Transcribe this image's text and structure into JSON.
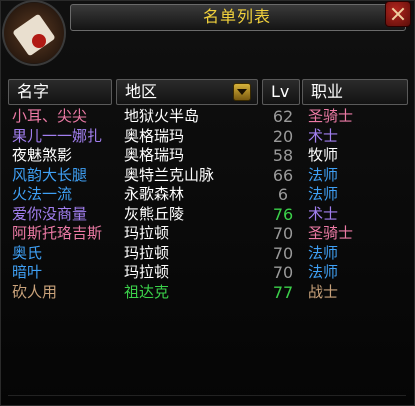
{
  "window": {
    "title": "名单列表"
  },
  "headers": {
    "name": "名字",
    "region": "地区",
    "level": "Lv",
    "class": "职业"
  },
  "colors": {
    "title": "#f2d23c",
    "paladin": "#ec7aa5",
    "warlock": "#a27ff0",
    "priest": "#ffffff",
    "mage": "#3fa0f5",
    "warrior": "#c9a27a",
    "level_grey": "#9a9a9a",
    "level_green": "#3bd14a",
    "region_white": "#ffffff",
    "region_green": "#3bd14a"
  },
  "rows": [
    {
      "name": "小耳、尖尖",
      "region": "地狱火半岛",
      "level": "62",
      "class": "圣骑士",
      "name_color": "#ec7aa5",
      "class_color": "#ec7aa5",
      "level_color": "#9a9a9a",
      "region_color": "#ffffff"
    },
    {
      "name": "果儿一一娜扎",
      "region": "奥格瑞玛",
      "level": "20",
      "class": "术士",
      "name_color": "#a27ff0",
      "class_color": "#a27ff0",
      "level_color": "#9a9a9a",
      "region_color": "#ffffff"
    },
    {
      "name": "夜魅煞影",
      "region": "奥格瑞玛",
      "level": "58",
      "class": "牧师",
      "name_color": "#ffffff",
      "class_color": "#ffffff",
      "level_color": "#9a9a9a",
      "region_color": "#ffffff"
    },
    {
      "name": "风韵大长腿",
      "region": "奥特兰克山脉",
      "level": "66",
      "class": "法师",
      "name_color": "#3fa0f5",
      "class_color": "#3fa0f5",
      "level_color": "#9a9a9a",
      "region_color": "#ffffff"
    },
    {
      "name": "火法一流",
      "region": "永歌森林",
      "level": "6",
      "class": "法师",
      "name_color": "#3fa0f5",
      "class_color": "#3fa0f5",
      "level_color": "#9a9a9a",
      "region_color": "#ffffff"
    },
    {
      "name": "爱你没商量",
      "region": "灰熊丘陵",
      "level": "76",
      "class": "术士",
      "name_color": "#a27ff0",
      "class_color": "#a27ff0",
      "level_color": "#3bd14a",
      "region_color": "#ffffff"
    },
    {
      "name": "阿斯托珞吉斯",
      "region": "玛拉顿",
      "level": "70",
      "class": "圣骑士",
      "name_color": "#ec7aa5",
      "class_color": "#ec7aa5",
      "level_color": "#9a9a9a",
      "region_color": "#ffffff"
    },
    {
      "name": "奥氏",
      "region": "玛拉顿",
      "level": "70",
      "class": "法师",
      "name_color": "#3fa0f5",
      "class_color": "#3fa0f5",
      "level_color": "#9a9a9a",
      "region_color": "#ffffff"
    },
    {
      "name": "暗叶",
      "region": "玛拉顿",
      "level": "70",
      "class": "法师",
      "name_color": "#3fa0f5",
      "class_color": "#3fa0f5",
      "level_color": "#9a9a9a",
      "region_color": "#ffffff"
    },
    {
      "name": "砍人用",
      "region": "祖达克",
      "level": "77",
      "class": "战士",
      "name_color": "#c9a27a",
      "class_color": "#c9a27a",
      "level_color": "#3bd14a",
      "region_color": "#3bd14a"
    }
  ]
}
